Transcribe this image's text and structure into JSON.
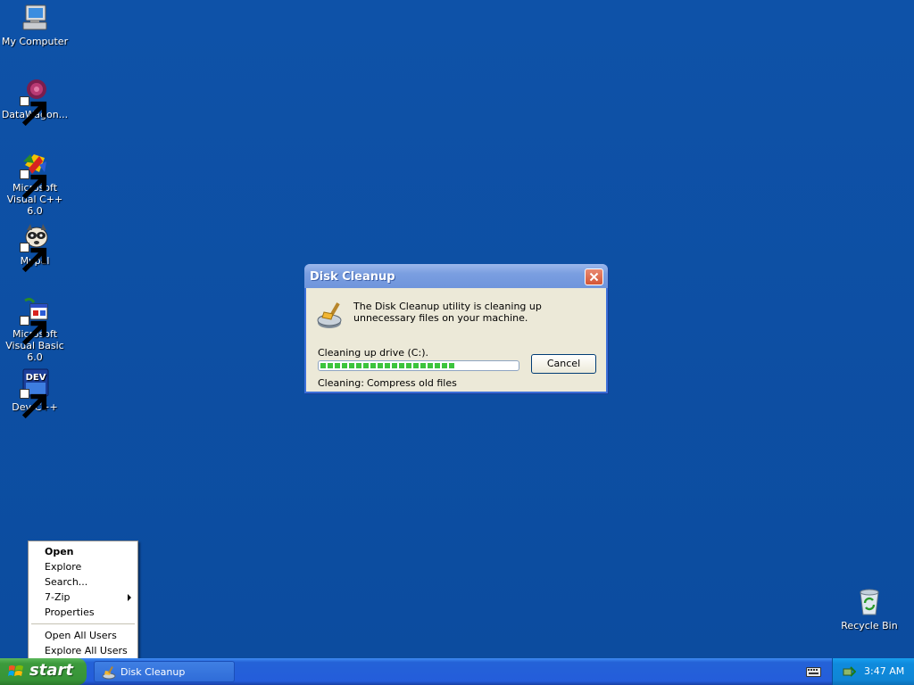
{
  "desktop": {
    "icons": [
      {
        "label": "My Computer",
        "icon": "my-computer-icon"
      },
      {
        "label": "DataWagon...",
        "icon": "datawagon-icon",
        "shortcut": true
      },
      {
        "label": "Microsoft Visual C++ 6.0",
        "icon": "visual-cpp-icon",
        "shortcut": true
      },
      {
        "label": "Mypal",
        "icon": "mypal-icon",
        "shortcut": true
      },
      {
        "label": "Microsoft Visual Basic 6.0",
        "icon": "visual-basic-icon",
        "shortcut": true
      },
      {
        "label": "Dev-C++",
        "icon": "dev-cpp-icon",
        "shortcut": true
      },
      {
        "label": "Recycle Bin",
        "icon": "recycle-bin-icon"
      }
    ],
    "dev_icon_text": "DEV"
  },
  "dialog": {
    "title": "Disk Cleanup",
    "message": "The Disk Cleanup utility is cleaning up unnecessary files on your machine.",
    "drive_label": "Cleaning up drive  (C:).",
    "progress": 0.68,
    "cancel_label": "Cancel",
    "status_label": "Cleaning:",
    "status_value": "Compress old files"
  },
  "context_menu": {
    "items": [
      {
        "label": "Open",
        "bold": true
      },
      {
        "label": "Explore"
      },
      {
        "label": "Search..."
      },
      {
        "label": "7-Zip",
        "submenu": true
      },
      {
        "label": "Properties"
      },
      {
        "label": "Open All Users"
      },
      {
        "label": "Explore All Users"
      }
    ]
  },
  "taskbar": {
    "start_label": "start",
    "task_label": "Disk Cleanup",
    "clock": "3:47 AM"
  },
  "colors": {
    "desktop": "#0d4fa3",
    "taskbar": "#245ddb",
    "start": "#3c9a3c",
    "progress": "#3cc43c"
  }
}
